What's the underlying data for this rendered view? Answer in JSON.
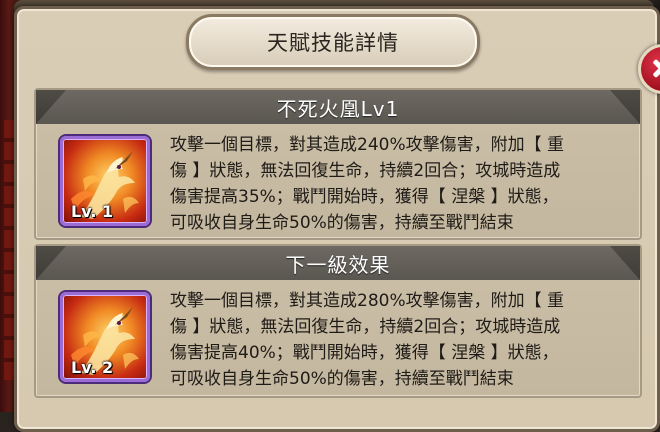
{
  "dialog": {
    "title": "天賦技能詳情"
  },
  "current_skill": {
    "name": "不死火凰Lv1",
    "level_badge": "Lv. 1",
    "icon": "phoenix-icon",
    "description_lines": [
      "攻擊一個目標，對其造成240%攻擊傷害，附加【 重",
      "傷 】狀態，無法回復生命，持續2回合；攻城時造成",
      "傷害提高35%；戰鬥開始時，獲得【 涅槃 】狀態，",
      "可吸收自身生命50%的傷害，持續至戰鬥結束"
    ]
  },
  "next_level": {
    "name": "下一級效果",
    "level_badge": "Lv. 2",
    "icon": "phoenix-icon",
    "description_lines": [
      "攻擊一個目標，對其造成280%攻擊傷害，附加【 重",
      "傷 】狀態，無法回復生命，持續2回合；攻城時造成",
      "傷害提高40%；戰鬥開始時，獲得【 涅槃 】狀態，",
      "可吸收自身生命50%的傷害，持續至戰鬥結束"
    ]
  },
  "colors": {
    "parchment": "#d6c9b0",
    "header": "#5f5b55",
    "icon_border": "#9b6cd6",
    "close_button": "#c0182a"
  }
}
